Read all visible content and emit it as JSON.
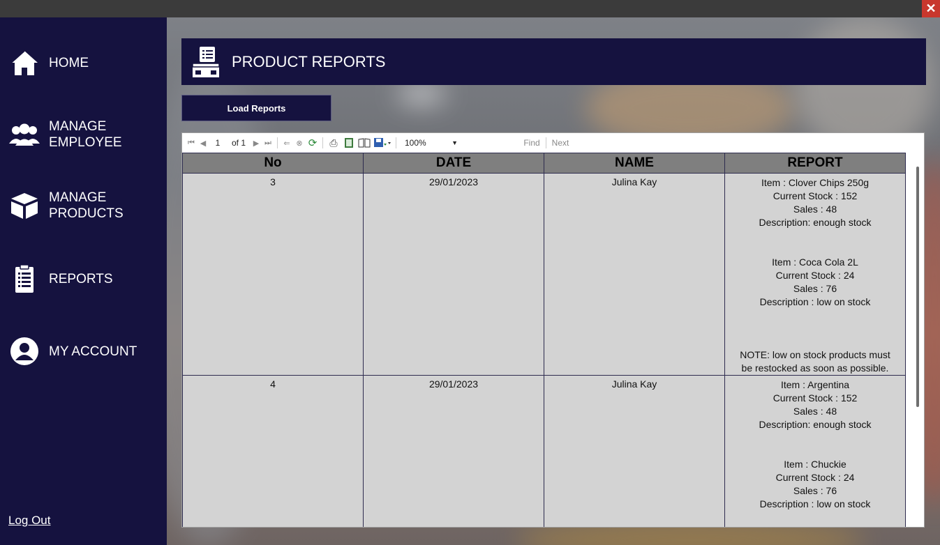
{
  "window": {
    "close_label": "✕"
  },
  "sidebar": {
    "items": [
      {
        "label_lines": [
          "HOME"
        ],
        "icon": "home-icon"
      },
      {
        "label_lines": [
          "MANAGE",
          "EMPLOYEE"
        ],
        "icon": "users-icon"
      },
      {
        "label_lines": [
          "MANAGE",
          "PRODUCTS"
        ],
        "icon": "box-icon"
      },
      {
        "label_lines": [
          "REPORTS"
        ],
        "icon": "clipboard-icon"
      },
      {
        "label_lines": [
          "MY ACCOUNT"
        ],
        "icon": "account-icon"
      }
    ],
    "logout_label": "Log Out"
  },
  "header": {
    "title": "PRODUCT REPORTS",
    "icon": "product-report-icon"
  },
  "load_button": {
    "label": "Load Reports"
  },
  "toolbar": {
    "page_current": "1",
    "page_of": "of 1",
    "zoom": "100%",
    "find_label": "Find",
    "next_label": "Next"
  },
  "table": {
    "headers": [
      "No",
      "DATE",
      "NAME",
      "REPORT"
    ],
    "rows": [
      {
        "no": "3",
        "date": "29/01/2023",
        "name": "Julina Kay",
        "report_lines": [
          "Item : Clover Chips 250g",
          "Current Stock : 152",
          "Sales : 48",
          "Description: enough stock",
          "",
          "",
          "Item : Coca Cola 2L",
          "Current Stock : 24",
          "Sales : 76",
          "Description : low on stock",
          "",
          "",
          "",
          "NOTE: low on stock products must",
          "be restocked as soon as possible."
        ]
      },
      {
        "no": "4",
        "date": "29/01/2023",
        "name": "Julina Kay",
        "report_lines": [
          "Item : Argentina",
          "Current Stock : 152",
          "Sales : 48",
          "Description: enough stock",
          "",
          "",
          "Item : Chuckie",
          "Current Stock : 24",
          "Sales : 76",
          "Description : low on stock"
        ]
      }
    ]
  },
  "colors": {
    "sidebar_bg": "#15123f",
    "header_bg": "#15123f",
    "table_header_bg": "#7f7f7f",
    "cell_bg": "#d3d3d3",
    "close_bg": "#c8372d"
  }
}
